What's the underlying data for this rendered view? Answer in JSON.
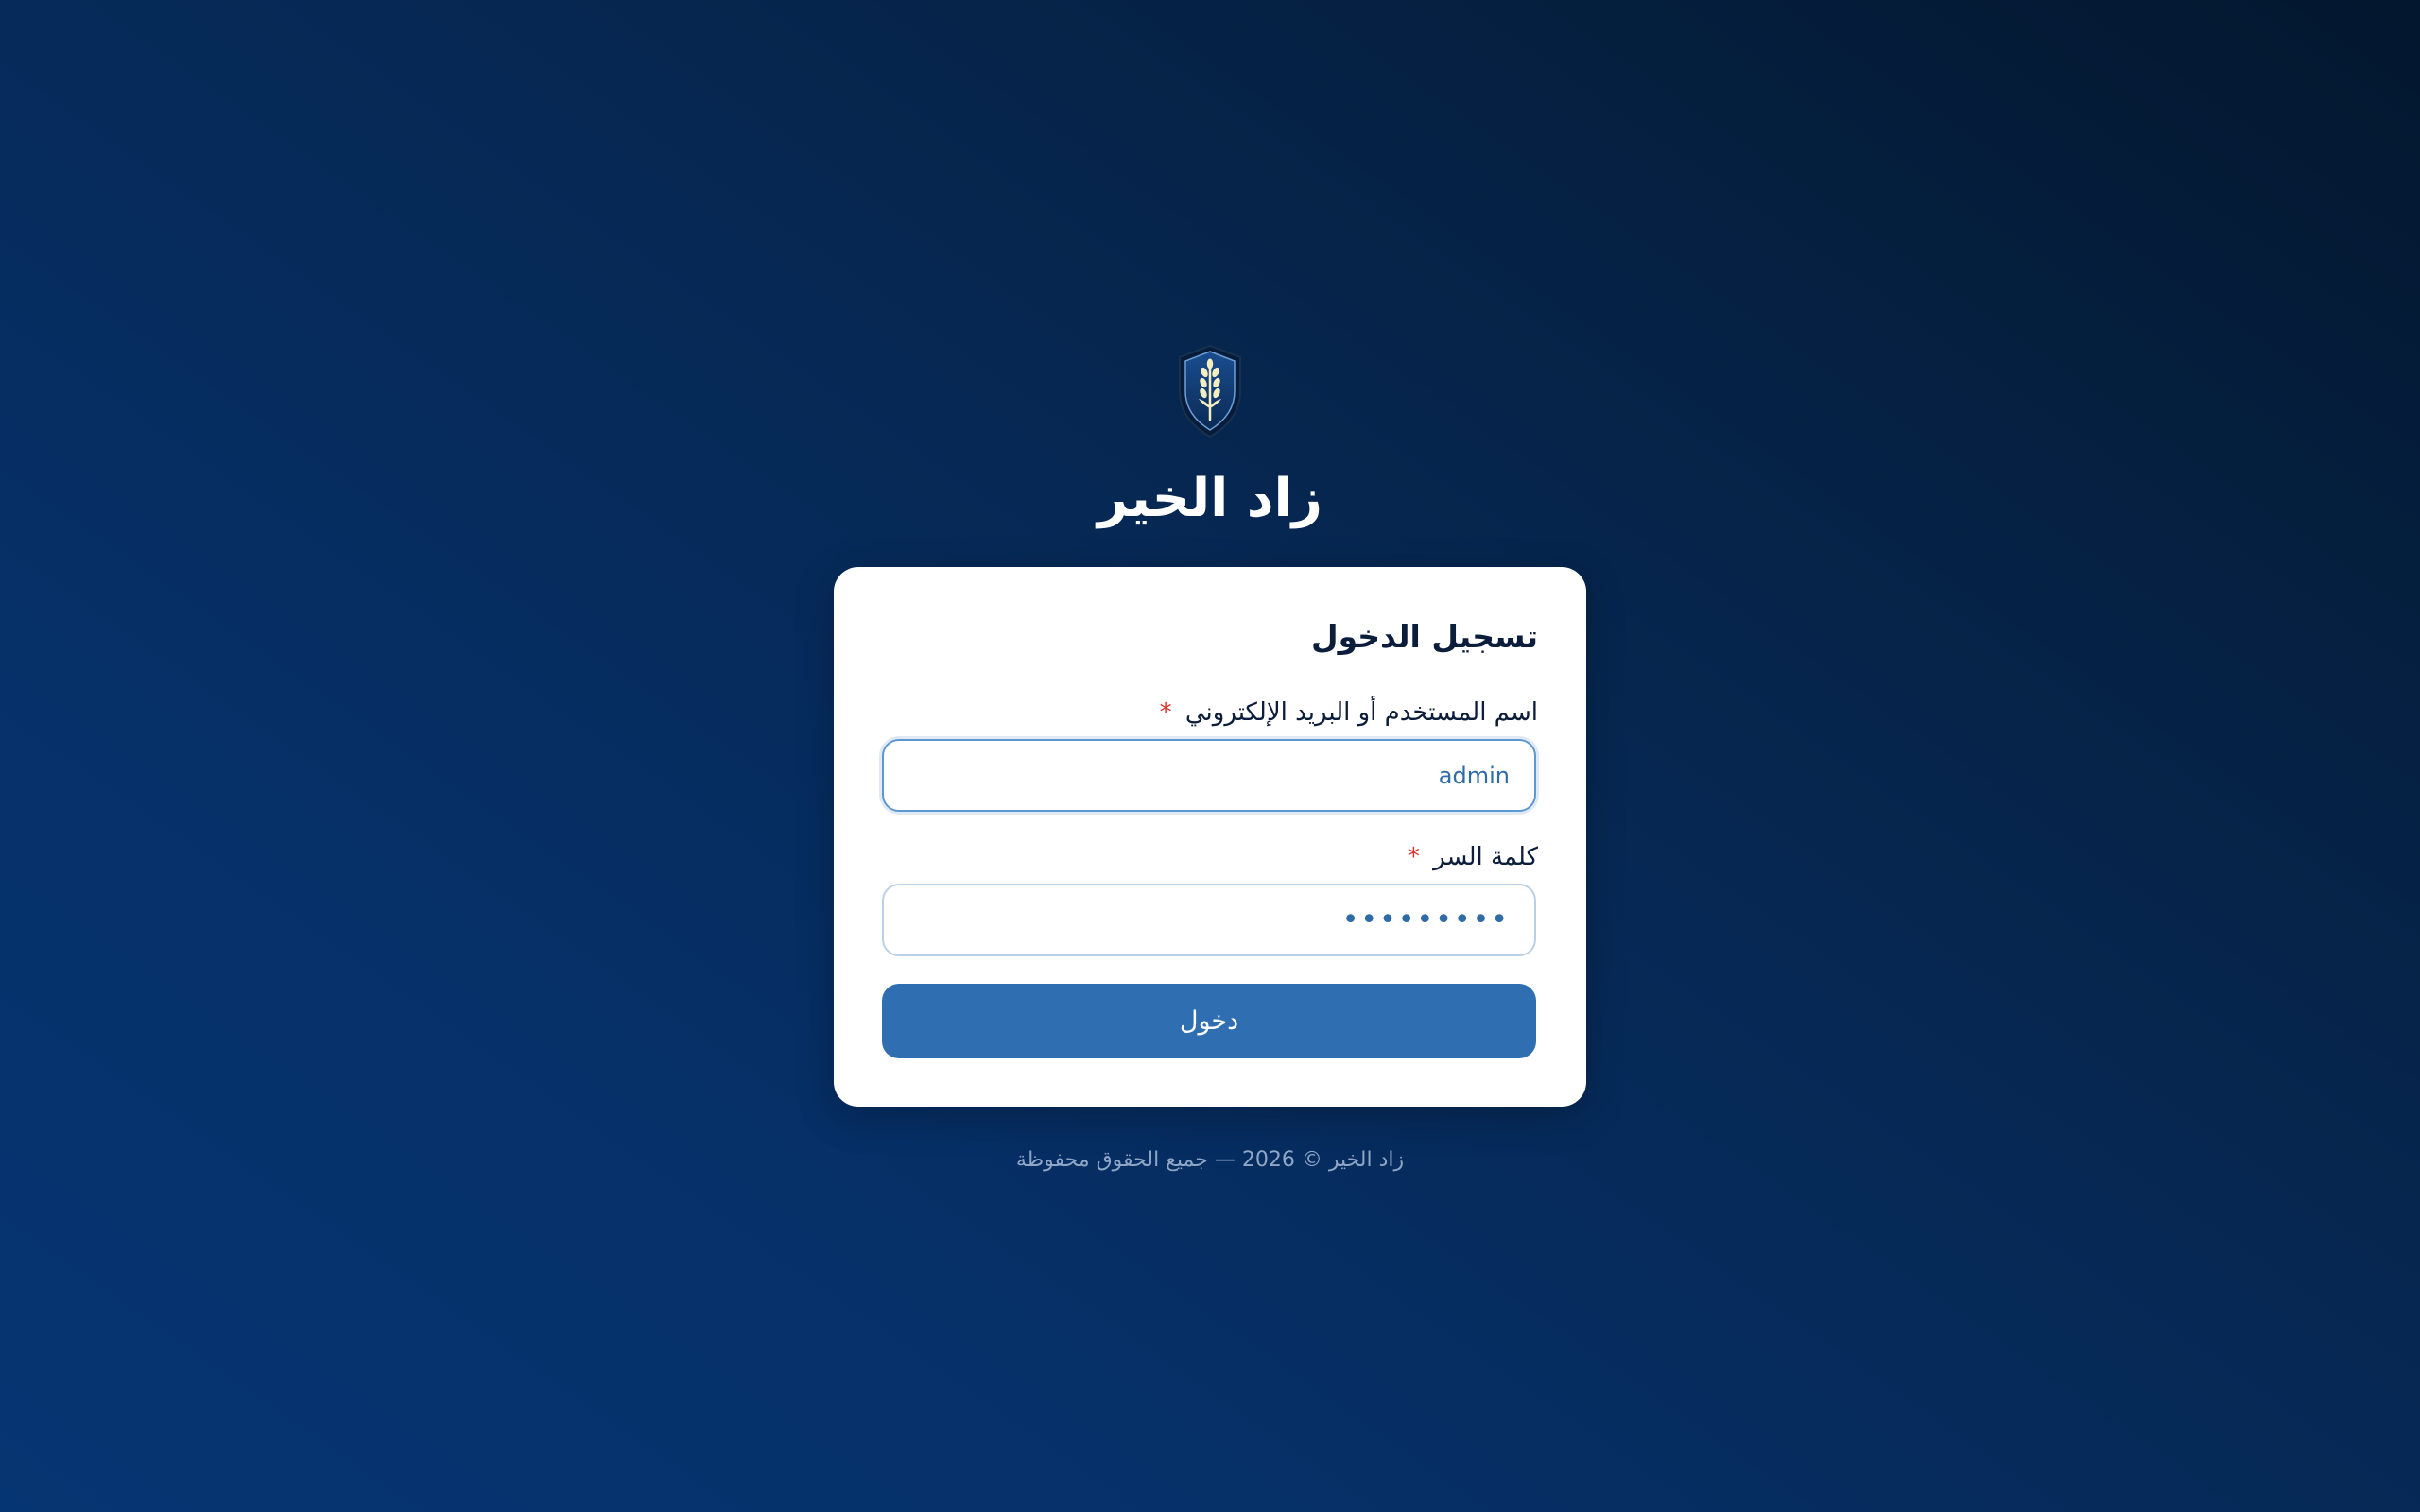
{
  "app": {
    "title": "زاد الخير",
    "logo_icon": "wheat-shield-icon"
  },
  "login_card": {
    "title": "تسجيل الدخول",
    "username_field": {
      "label": "اسم المستخدم أو البريد الإلكتروني",
      "required_marker": "*",
      "value": "admin"
    },
    "password_field": {
      "label": "كلمة السر",
      "required_marker": "*",
      "value": "•••••••••"
    },
    "submit_label": "دخول"
  },
  "footer": {
    "text": "زاد الخير © 2026 — جميع الحقوق محفوظة"
  },
  "colors": {
    "background_top": "#03172e",
    "background_bottom": "#063573",
    "card": "#ffffff",
    "primary_button": "#2f6fb1",
    "required_marker": "#d9342b",
    "logo_shield": "#0a3266",
    "logo_wheat": "#f3eec2"
  }
}
